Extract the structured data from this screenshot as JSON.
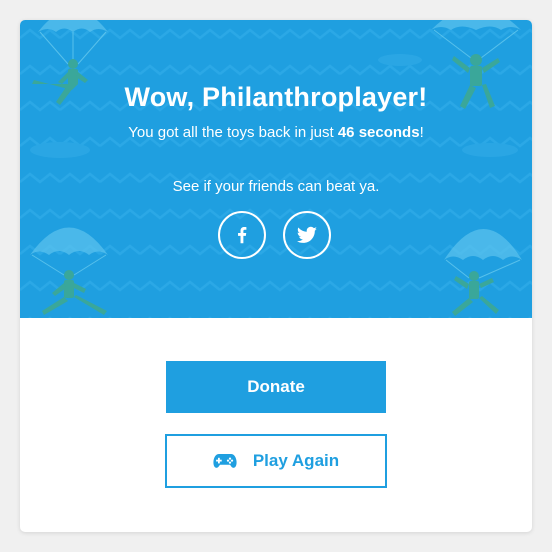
{
  "banner": {
    "headline": "Wow, Philanthroplayer!",
    "result_prefix": "You got all the toys back in just ",
    "result_time": "46 seconds",
    "result_suffix": "!",
    "challenge": "See if your friends can beat ya.",
    "background_color": "#1f9fe0",
    "decoration_icon": "paratrooper-toy-soldier-icon"
  },
  "share": {
    "facebook_icon": "facebook-icon",
    "twitter_icon": "twitter-icon"
  },
  "actions": {
    "donate_label": "Donate",
    "play_again_label": "Play Again",
    "play_again_icon": "gamepad-icon",
    "accent_color": "#1f9fe0"
  }
}
